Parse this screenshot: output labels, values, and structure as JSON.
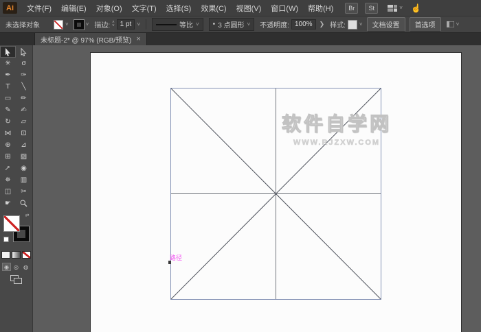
{
  "app": {
    "logo_text": "Ai"
  },
  "menu": {
    "items": [
      "文件(F)",
      "编辑(E)",
      "对象(O)",
      "文字(T)",
      "选择(S)",
      "效果(C)",
      "视图(V)",
      "窗口(W)",
      "帮助(H)"
    ],
    "br_label": "Br",
    "st_label": "St"
  },
  "glyphs": {
    "caret_down": "˅",
    "stepper_up": "˄",
    "stepper_down": "˅",
    "chevron_right": "❯",
    "swap": "⇄",
    "close": "×",
    "touch": "☝"
  },
  "control_bar": {
    "selection_status": "未选择对象",
    "stroke_label": "描边:",
    "stroke_value": "1 pt",
    "width_profile_label": "等比",
    "brush_bullet": "•",
    "brush_label": "3 点圆形",
    "opacity_label": "不透明度:",
    "opacity_value": "100%",
    "style_label": "样式:",
    "document_setup_label": "文档设置",
    "preferences_label": "首选项"
  },
  "tab_bar": {
    "active_tab": "未标题-2* @ 97% (RGB/预览)"
  },
  "toolbar": {
    "tools": [
      {
        "name": "selection",
        "glyph": ""
      },
      {
        "name": "direct-selection",
        "glyph": ""
      },
      {
        "name": "magic-wand",
        "glyph": "✳"
      },
      {
        "name": "lasso",
        "glyph": "σ"
      },
      {
        "name": "pen",
        "glyph": "✒"
      },
      {
        "name": "curvature",
        "glyph": "✑"
      },
      {
        "name": "type",
        "glyph": "T"
      },
      {
        "name": "line-segment",
        "glyph": "╲"
      },
      {
        "name": "rectangle",
        "glyph": "▭"
      },
      {
        "name": "paintbrush",
        "glyph": "✏"
      },
      {
        "name": "pencil",
        "glyph": "✎"
      },
      {
        "name": "blob-brush",
        "glyph": "✍"
      },
      {
        "name": "rotate",
        "glyph": "↻"
      },
      {
        "name": "scale",
        "glyph": "▱"
      },
      {
        "name": "width",
        "glyph": "⋈"
      },
      {
        "name": "free-transform",
        "glyph": "⊡"
      },
      {
        "name": "shape-builder",
        "glyph": "⊕"
      },
      {
        "name": "perspective-grid",
        "glyph": "⊿"
      },
      {
        "name": "mesh",
        "glyph": "⊞"
      },
      {
        "name": "gradient",
        "glyph": "▨"
      },
      {
        "name": "eyedropper",
        "glyph": "⊸"
      },
      {
        "name": "blend",
        "glyph": "◉"
      },
      {
        "name": "symbol-sprayer",
        "glyph": "✵"
      },
      {
        "name": "graph",
        "glyph": "▥"
      },
      {
        "name": "artboard",
        "glyph": "◫"
      },
      {
        "name": "slice",
        "glyph": "✂"
      },
      {
        "name": "hand",
        "glyph": "☛"
      },
      {
        "name": "zoom",
        "glyph": ""
      }
    ],
    "drawing_modes": [
      "◉",
      "◎",
      "◍"
    ]
  },
  "canvas": {
    "watermark_line1": "软件自学网",
    "watermark_line2": "WWW.RJZXW.COM",
    "smart_guide_label": "路径"
  },
  "colors": {
    "accent_orange": "#e8872e",
    "smart_guide_pink": "#f25af2",
    "square_stroke": "#8391b4",
    "diagonal_stroke": "#4e525c",
    "midline_stroke": "#70747c"
  }
}
